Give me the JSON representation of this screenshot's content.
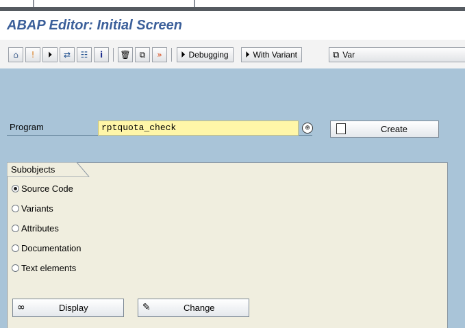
{
  "window": {
    "title": "ABAP Editor: Initial Screen"
  },
  "toolbar": {
    "icons": [
      "other-object-icon",
      "active-inactive-icon",
      "execute-icon",
      "where-used-icon",
      "object-list-icon",
      "display-object-icon",
      "delete-icon",
      "copy-icon",
      "rename-icon"
    ],
    "debugging_label": "Debugging",
    "with_variant_label": "With Variant",
    "variants_label": "Var"
  },
  "program": {
    "label": "Program",
    "value": "rptquota_check",
    "create_label": "Create"
  },
  "subobjects": {
    "title": "Subobjects",
    "options": [
      {
        "label": "Source Code",
        "checked": true
      },
      {
        "label": "Variants",
        "checked": false
      },
      {
        "label": "Attributes",
        "checked": false
      },
      {
        "label": "Documentation",
        "checked": false
      },
      {
        "label": "Text elements",
        "checked": false
      }
    ]
  },
  "actions": {
    "display_label": "Display",
    "change_label": "Change"
  },
  "colors": {
    "title": "#3b5f9a",
    "workarea": "#a9c4d8",
    "input_bg": "#fff6a8",
    "groupbox_bg": "#f0eedf"
  }
}
